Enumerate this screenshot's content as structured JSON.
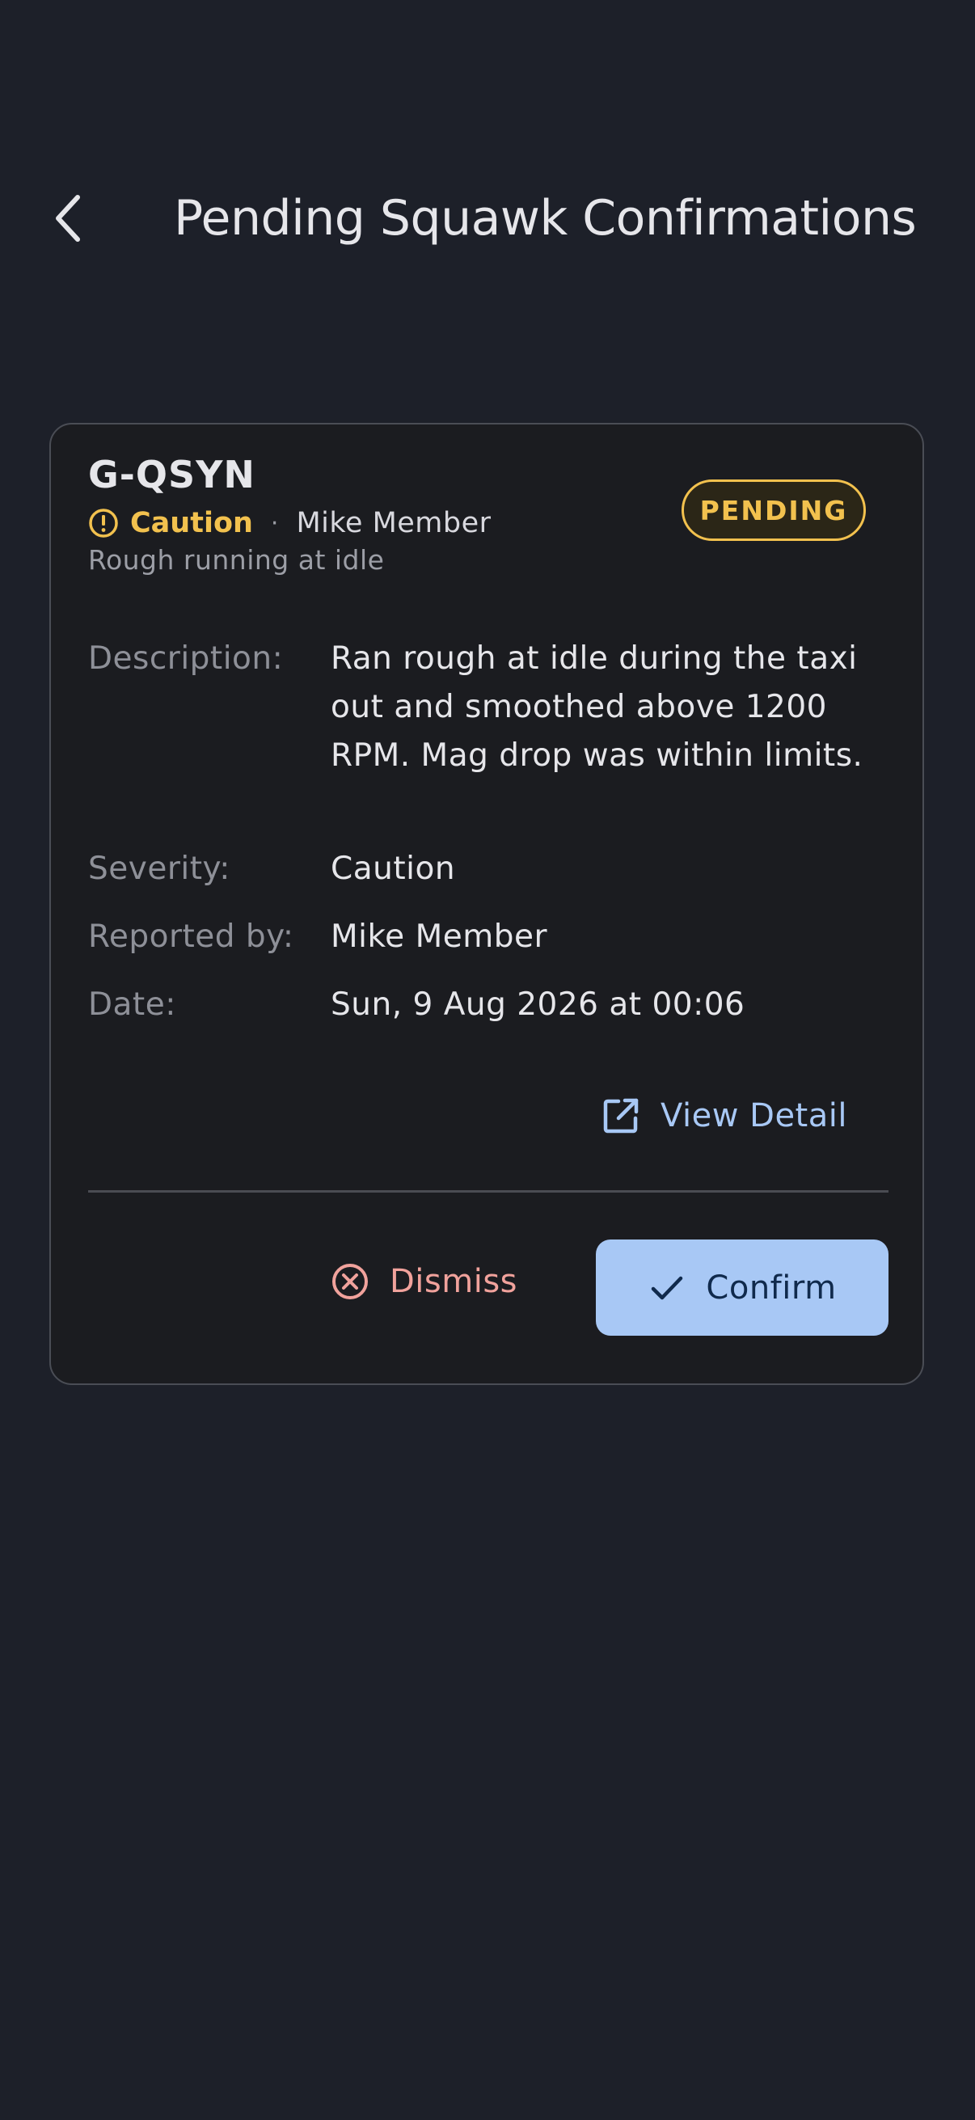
{
  "header": {
    "title": "Pending Squawk Confirmations",
    "back_icon": "chevron-left-icon"
  },
  "card": {
    "registration": "G-QSYN",
    "severity": "Caution",
    "severity_icon": "alert-circle-icon",
    "separator": "·",
    "reporter": "Mike Member",
    "summary": "Rough running at idle",
    "status": "PENDING",
    "details": {
      "description_label": "Description:",
      "description_value": "Ran rough at idle during the taxi out and smoothed above 1200 RPM. Mag drop was within limits.",
      "severity_label": "Severity:",
      "severity_value": "Caution",
      "reported_by_label": "Reported by:",
      "reported_by_value": "Mike Member",
      "date_label": "Date:",
      "date_value": "Sun, 9 Aug 2026 at 00:06"
    },
    "view_detail_label": "View Detail",
    "view_detail_icon": "open-in-new-icon",
    "dismiss_label": "Dismiss",
    "dismiss_icon": "cancel-circle-icon",
    "confirm_label": "Confirm",
    "confirm_icon": "check-icon"
  },
  "colors": {
    "background": "#1d2029",
    "card_background": "#1b1c20",
    "caution": "#f2c14e",
    "accent": "#a8c8f5",
    "dismiss": "#f1a29c"
  }
}
